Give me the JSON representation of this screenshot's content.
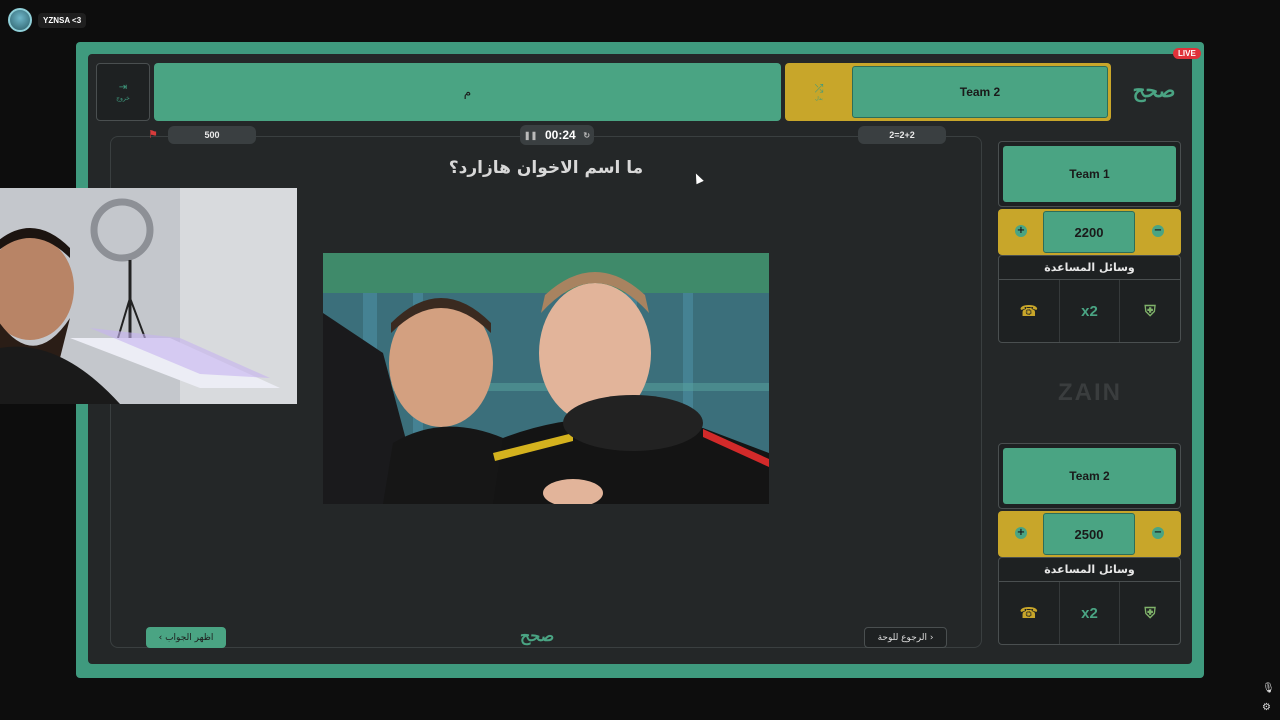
{
  "stream": {
    "username": "YZNSA <3",
    "live_badge": "LIVE"
  },
  "header": {
    "exit_label": "خروج",
    "team1_label": "م",
    "swap_label": "بدل",
    "team2_label": "Team 2",
    "logo_text": "صحح"
  },
  "question_panel": {
    "points": "500",
    "timer": "00:24",
    "helper_badge": "2=2+2",
    "question": "ما اسم الاخوان هازارد؟",
    "show_answer": "اظهر الجواب ›",
    "back_to_board": "‹ الرجوع للوحة"
  },
  "teams": [
    {
      "name": "Team 1",
      "score": "2200",
      "help_title": "وسائل المساعدة",
      "tools": [
        "call-friend-icon",
        "x2",
        "shield-icon"
      ]
    },
    {
      "name": "Team 2",
      "score": "2500",
      "help_title": "وسائل المساعدة",
      "tools": [
        "call-friend-icon",
        "x2",
        "shield-icon"
      ]
    }
  ],
  "sponsor": "ZAIN",
  "colors": {
    "accent_green": "#4aa483",
    "accent_gold": "#c8a62a",
    "live_red": "#e0323a",
    "board_bg": "#242728"
  }
}
